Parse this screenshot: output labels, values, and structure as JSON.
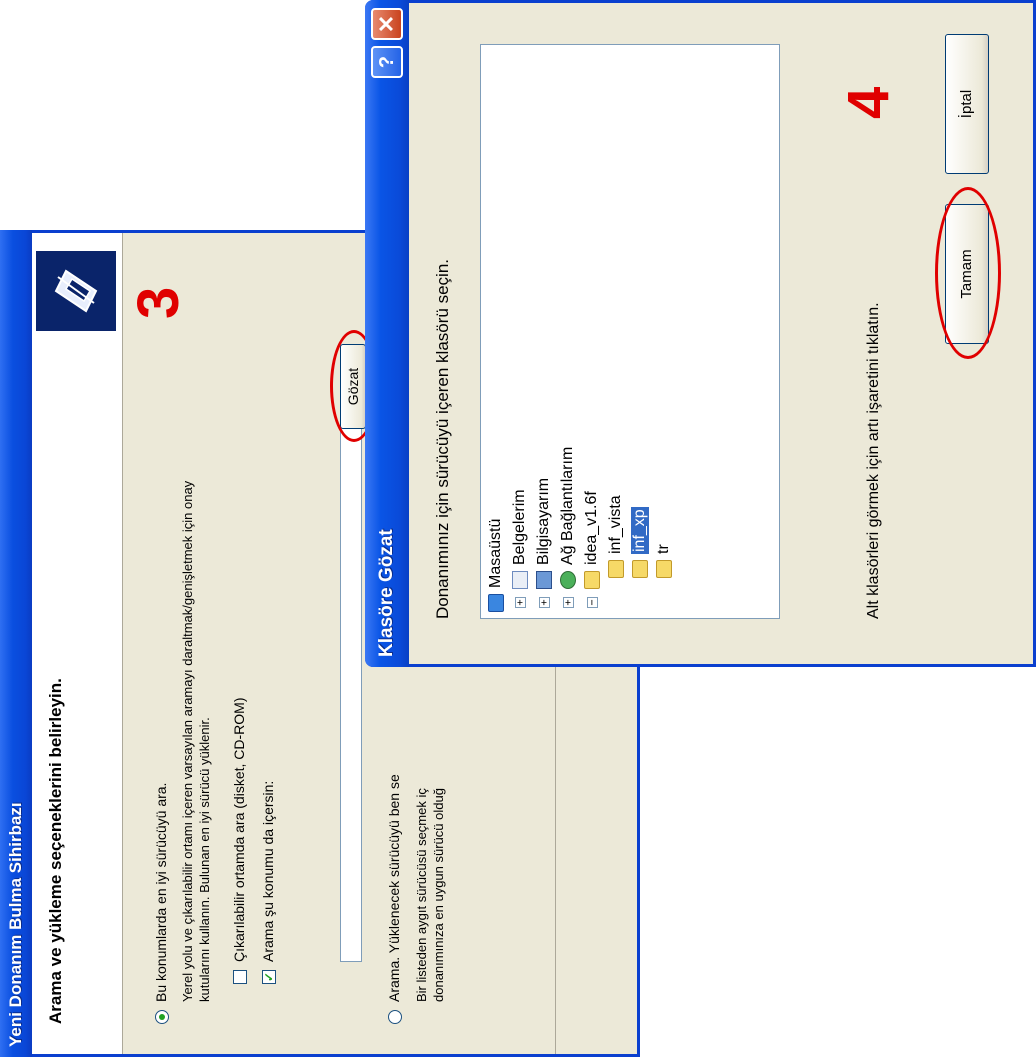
{
  "wizard": {
    "title": "Yeni Donanım Bulma Sihirbazı",
    "heading": "Arama ve yükleme seçeneklerini belirleyin.",
    "option_search": {
      "label": "Bu konumlarda en iyi sürücüyü ara.",
      "desc_line1": "Yerel yolu ve çıkarılabilir ortamı içeren varsayılan aramayı daraltmak/genişletmek için onay",
      "desc_line2": "kutularını kullanın. Bulunan en iyi sürücü yüklenir.",
      "selected": true
    },
    "checkbox_removable": {
      "label": "Çıkarılabilir ortamda ara (disket, CD-ROM)",
      "checked": false
    },
    "checkbox_location": {
      "label": "Arama şu konumu da içersin:",
      "checked": true
    },
    "location_value": "",
    "browse_button": "Gözat",
    "option_manual": {
      "label": "Arama. Yüklenecek sürücüyü ben se",
      "desc_line1": "Bir listeden aygıt sürücüsü seçmek iç",
      "desc_line2": "donanımınıza en uygun sürücü olduğ",
      "selected": false
    }
  },
  "browse_dialog": {
    "title": "Klasöre Gözat",
    "instruction": "Donanımınız için sürücüyü içeren klasörü seçin.",
    "tree": [
      {
        "label": "Masaüstü",
        "icon": "desktop-icon",
        "toggle": ""
      },
      {
        "label": "Belgelerim",
        "icon": "documents-icon",
        "toggle": "+"
      },
      {
        "label": "Bilgisayarım",
        "icon": "computer-icon",
        "toggle": "+"
      },
      {
        "label": "Ağ Bağlantılarım",
        "icon": "network-icon",
        "toggle": "+"
      },
      {
        "label": "idea_v1.6f",
        "icon": "folder-icon",
        "toggle": "−"
      },
      {
        "label": "inf_vista",
        "icon": "folder-icon",
        "toggle": ""
      },
      {
        "label": "inf_xp",
        "icon": "folder-icon",
        "toggle": "",
        "selected": true
      },
      {
        "label": "tr",
        "icon": "folder-icon",
        "toggle": ""
      }
    ],
    "hint": "Alt klasörleri görmek için artı işaretini tıklatın.",
    "ok_button": "Tamam",
    "cancel_button": "İptal",
    "help_glyph": "?",
    "close_glyph": "✕"
  },
  "annotations": {
    "step3": "3",
    "step4": "4"
  },
  "colors": {
    "title_blue": "#0a4fe0",
    "annotation_red": "#e00000",
    "window_bg": "#ece9d8"
  }
}
